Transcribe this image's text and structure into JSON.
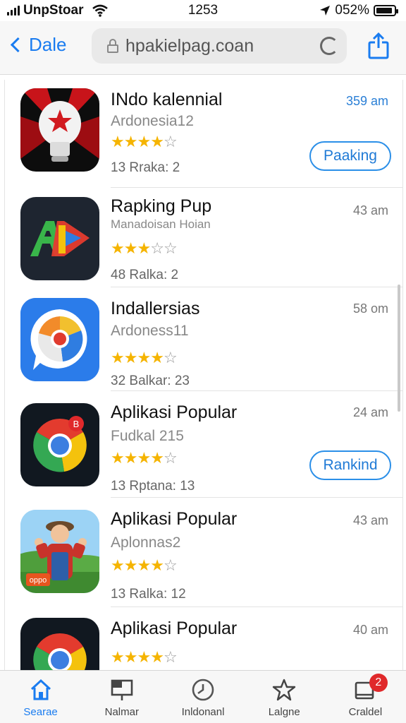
{
  "status_bar": {
    "carrier": "UnpStoar",
    "time": "1253",
    "battery": "052%"
  },
  "nav": {
    "back_label": "Dale",
    "url": "hpakielpag.coan"
  },
  "apps": [
    {
      "title": "INdo kalennial",
      "subtitle": "Ardonesia12",
      "rating": 3.5,
      "meta": "13 Rraka: 2",
      "time": "359 am",
      "action": "Paaking"
    },
    {
      "title": "Rapking Pup",
      "subtitle": "Manadoisan Hoian",
      "rating": 3,
      "meta": "48 Ralka: 2",
      "time": "43 am"
    },
    {
      "title": "Indallersias",
      "subtitle": "Ardoness11",
      "rating": 4,
      "meta": "32 Balkar: 23",
      "time": "58 om"
    },
    {
      "title": "Aplikasi Popular",
      "subtitle": "Fudkal 215",
      "rating": 3.5,
      "meta": "13 Rptana: 13",
      "time": "24 am",
      "action": "Rankind"
    },
    {
      "title": "Aplikasi Popular",
      "subtitle": "Aplonnas2",
      "rating": 4,
      "meta": "13 Ralka: 12",
      "time": "43 am"
    },
    {
      "title": "Aplikasi Popular",
      "subtitle": "",
      "rating": 4,
      "meta": "",
      "time": "40 am"
    }
  ],
  "app_icon_badge": "B",
  "app5_icon_label": "oppo",
  "tabs": [
    {
      "label": "Searae",
      "icon": "home-icon",
      "active": true
    },
    {
      "label": "Nalmar",
      "icon": "billboard-icon"
    },
    {
      "label": "Inldonanl",
      "icon": "clock-icon"
    },
    {
      "label": "Lalgne",
      "icon": "star-icon"
    },
    {
      "label": "Craldel",
      "icon": "updates-icon",
      "badge": "2"
    }
  ],
  "colors": {
    "accent": "#1a7cf0",
    "star": "#f5b400",
    "badge": "#e0292b"
  }
}
